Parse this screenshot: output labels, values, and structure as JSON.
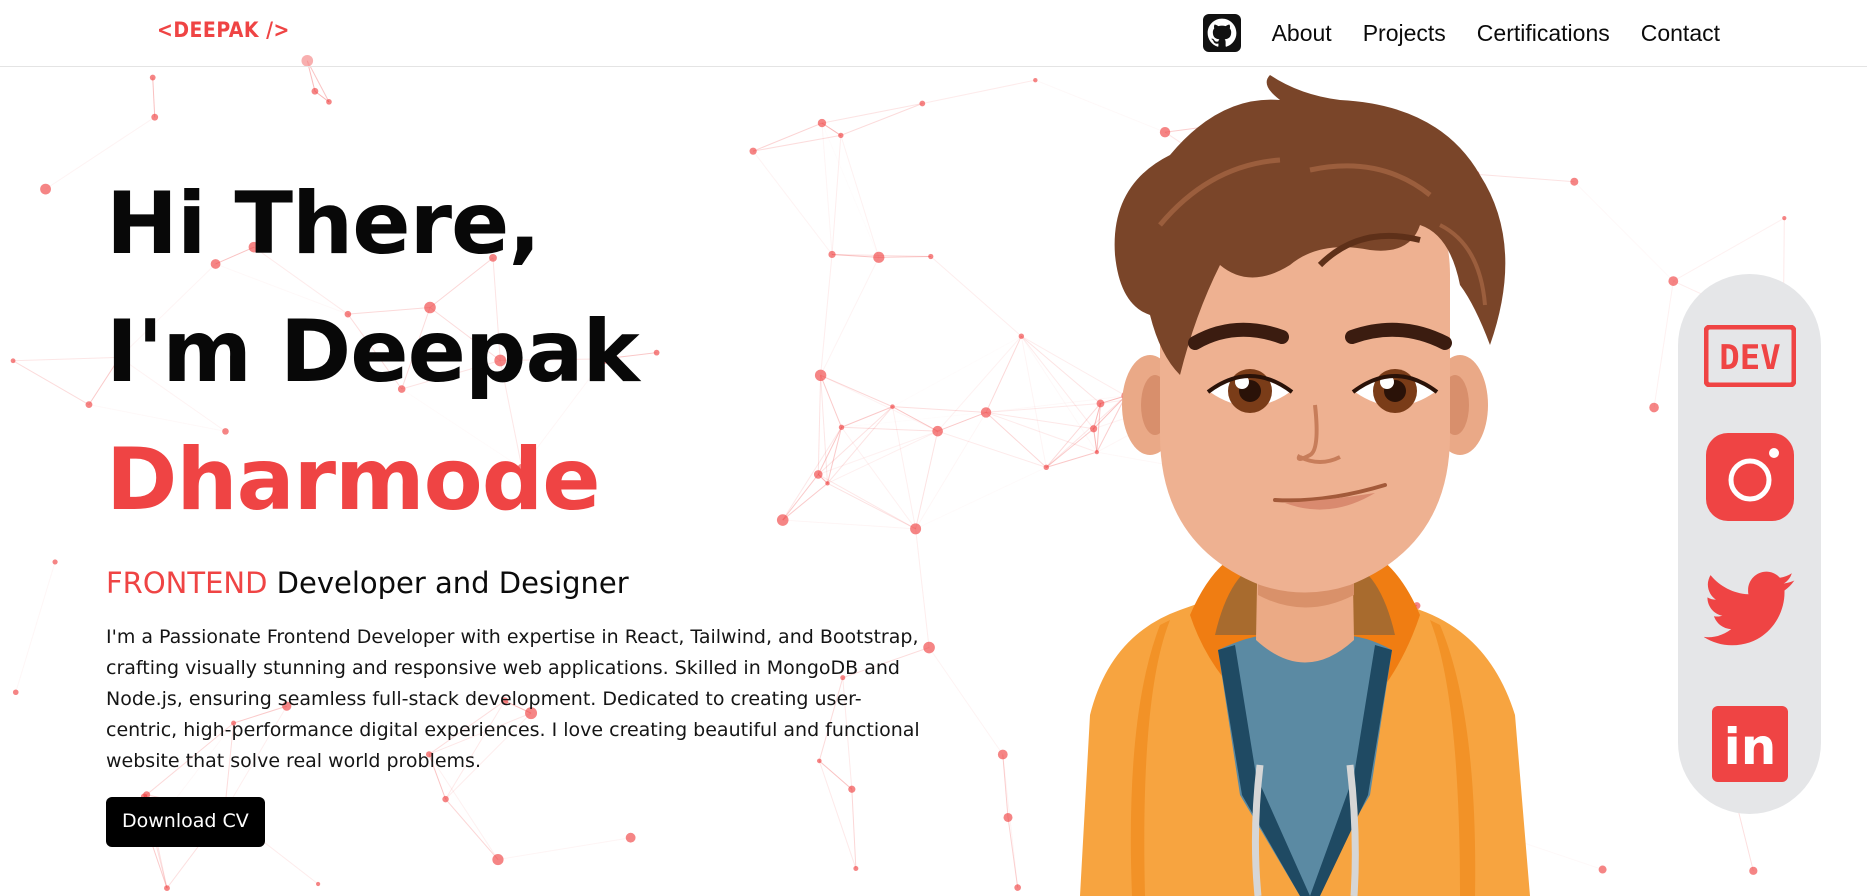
{
  "header": {
    "logo": "<DEEPAK />",
    "nav": [
      "About",
      "Projects",
      "Certifications",
      "Contact"
    ]
  },
  "hero": {
    "line1": "Hi There,",
    "line2": "I'm Deepak",
    "line3": "Dharmode",
    "role_highlight": "FRONTEND",
    "role_rest": " Developer and Designer",
    "bio": "I'm a Passionate Frontend Developer with expertise in React, Tailwind, and Bootstrap, crafting visually stunning and responsive web applications. Skilled in MongoDB and Node.js, ensuring seamless full-stack development. Dedicated to creating user-centric, high-performance digital experiences. I love creating beautiful and functional website that solve real world problems.",
    "cta": "Download CV"
  },
  "social": {
    "dev_label": "DEV",
    "linkedin_label": "in"
  },
  "colors": {
    "accent": "#ef4444",
    "dark": "#0b0b0b",
    "rail": "#e5e6e8"
  },
  "icons": [
    "github-icon",
    "dev-icon",
    "instagram-icon",
    "twitter-icon",
    "linkedin-icon"
  ]
}
